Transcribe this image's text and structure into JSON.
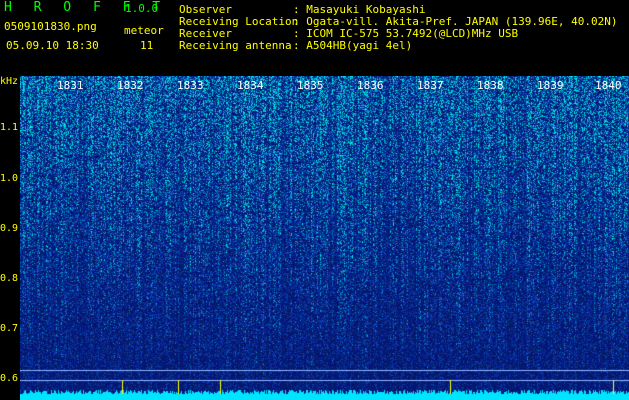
{
  "app": {
    "brand": "H R O F F T",
    "version": "1.0.0"
  },
  "file": {
    "name": "0509101830.png",
    "datetime": "05.09.10 18:30"
  },
  "meteor": {
    "label": "meteor",
    "count": "11"
  },
  "info": {
    "observer_label": "Observer",
    "observer_value": ": Masayuki Kobayashi",
    "location_label": "Receiving Location",
    "location_value": ": Ogata-vill. Akita-Pref. JAPAN (139.96E, 40.02N)",
    "receiver_label": "Receiver",
    "receiver_value": ": ICOM IC-575 53.7492(@LCD)MHz USB",
    "antenna_label": "Receiving antenna",
    "antenna_value": ": A504HB(yagi 4el)"
  },
  "yaxis": {
    "unit": "kHz",
    "labels": [
      "1.1",
      "1.0",
      "0.9",
      "0.8",
      "0.7",
      "0.6"
    ]
  },
  "time_labels": [
    "1831",
    "1832",
    "1833",
    "1834",
    "1835",
    "1836",
    "1837",
    "1838",
    "1839",
    "1840"
  ],
  "colors": {
    "background": "#000000",
    "text": "#ffff00",
    "accent": "#00ff00",
    "noise_low": "#0a1c8a",
    "noise_high": "#00e5ff"
  }
}
